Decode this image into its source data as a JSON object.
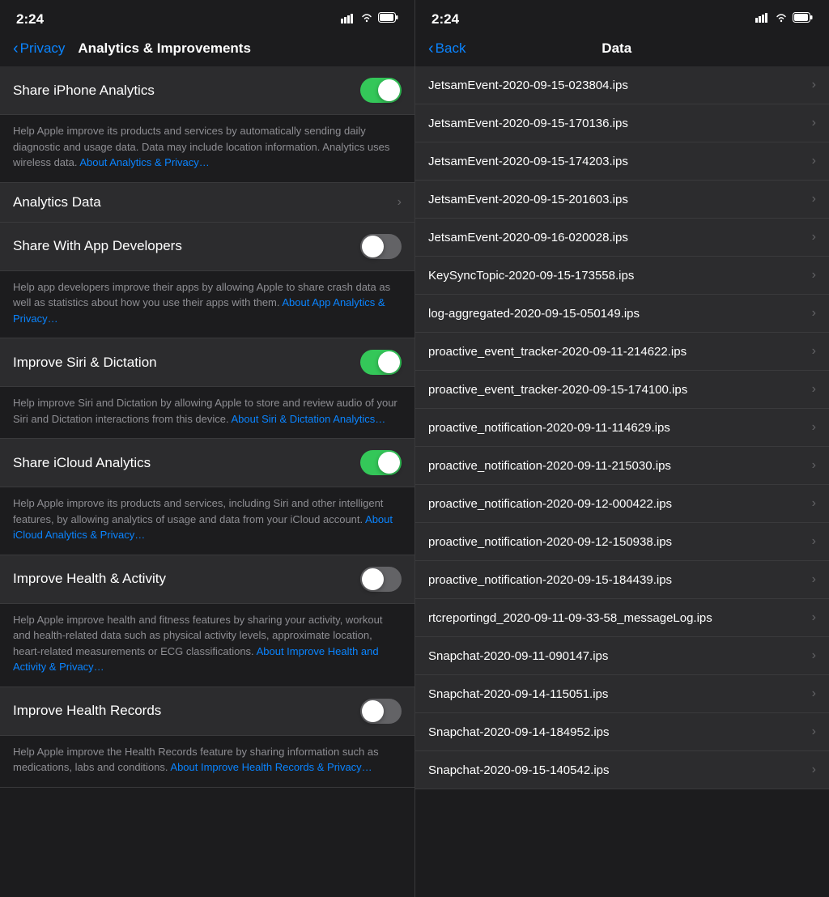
{
  "left": {
    "status": {
      "time": "2:24",
      "signal": "▌▌▌",
      "wifi": "wifi",
      "battery": "battery"
    },
    "nav": {
      "back_label": "Privacy",
      "title": "Analytics & Improvements"
    },
    "settings": [
      {
        "id": "share-iphone-analytics",
        "label": "Share iPhone Analytics",
        "type": "toggle",
        "state": "on",
        "description": "Help Apple improve its products and services by automatically sending daily diagnostic and usage data. Data may include location information. Analytics uses wireless data.",
        "link": "About Analytics & Privacy…"
      },
      {
        "id": "analytics-data",
        "label": "Analytics Data",
        "type": "chevron",
        "state": null,
        "description": null,
        "link": null
      },
      {
        "id": "share-with-app-developers",
        "label": "Share With App Developers",
        "type": "toggle",
        "state": "off",
        "description": "Help app developers improve their apps by allowing Apple to share crash data as well as statistics about how you use their apps with them.",
        "link": "About App Analytics & Privacy…"
      },
      {
        "id": "improve-siri-dictation",
        "label": "Improve Siri & Dictation",
        "type": "toggle",
        "state": "on",
        "description": "Help improve Siri and Dictation by allowing Apple to store and review audio of your Siri and Dictation interactions from this device.",
        "link": "About Siri & Dictation Analytics…"
      },
      {
        "id": "share-icloud-analytics",
        "label": "Share iCloud Analytics",
        "type": "toggle",
        "state": "on",
        "description": "Help Apple improve its products and services, including Siri and other intelligent features, by allowing analytics of usage and data from your iCloud account.",
        "link": "About iCloud Analytics & Privacy…"
      },
      {
        "id": "improve-health-activity",
        "label": "Improve Health & Activity",
        "type": "toggle",
        "state": "off",
        "description": "Help Apple improve health and fitness features by sharing your activity, workout and health-related data such as physical activity levels, approximate location, heart-related measurements or ECG classifications.",
        "link": "About Improve Health and Activity & Privacy…"
      },
      {
        "id": "improve-health-records",
        "label": "Improve Health Records",
        "type": "toggle",
        "state": "off",
        "description": "Help Apple improve the Health Records feature by sharing information such as medications, labs and conditions.",
        "link": "About Improve Health Records & Privacy…"
      }
    ]
  },
  "right": {
    "status": {
      "time": "2:24",
      "signal": "▌▌▌",
      "wifi": "wifi",
      "battery": "battery"
    },
    "nav": {
      "back_label": "Back",
      "title": "Data"
    },
    "items": [
      "JetsamEvent-2020-09-15-023804.ips",
      "JetsamEvent-2020-09-15-170136.ips",
      "JetsamEvent-2020-09-15-174203.ips",
      "JetsamEvent-2020-09-15-201603.ips",
      "JetsamEvent-2020-09-16-020028.ips",
      "KeySyncTopic-2020-09-15-173558.ips",
      "log-aggregated-2020-09-15-050149.ips",
      "proactive_event_tracker-2020-09-11-214622.ips",
      "proactive_event_tracker-2020-09-15-174100.ips",
      "proactive_notification-2020-09-11-114629.ips",
      "proactive_notification-2020-09-11-215030.ips",
      "proactive_notification-2020-09-12-000422.ips",
      "proactive_notification-2020-09-12-150938.ips",
      "proactive_notification-2020-09-15-184439.ips",
      "rtcreportingd_2020-09-11-09-33-58_messageLog.ips",
      "Snapchat-2020-09-11-090147.ips",
      "Snapchat-2020-09-14-115051.ips",
      "Snapchat-2020-09-14-184952.ips",
      "Snapchat-2020-09-15-140542.ips"
    ]
  }
}
